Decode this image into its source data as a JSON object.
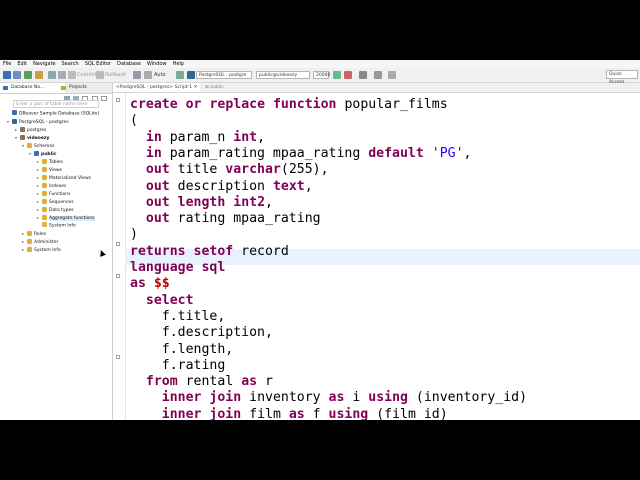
{
  "menu": [
    "File",
    "Edit",
    "Navigate",
    "Search",
    "SQL Editor",
    "Database",
    "Window",
    "Help"
  ],
  "toolbar": {
    "commit_label": "Commit",
    "rollback_label": "Rollback",
    "mode_label": "Auto",
    "datasource_combo": "PostgreSQL - postgre",
    "schema_combo": "public@videoezy",
    "limit_value": "20000",
    "quick_access_placeholder": "Quick Access"
  },
  "left_panel": {
    "tabs": [
      "Database Na...",
      "Projects"
    ],
    "filter_placeholder": "Enter a part of table name here",
    "tree": [
      {
        "label": "DBeaver Sample Database (SQLite)",
        "color": "#3b6fb6"
      },
      {
        "label": "PostgreSQL - postgres",
        "color": "#336791"
      },
      {
        "label": "postgres",
        "color": "#8d6e63"
      },
      {
        "label": "videoezy",
        "color": "#8d6e63"
      },
      {
        "label": "Schemas",
        "color": "#e0b040"
      },
      {
        "label": "public",
        "color": "#3b6fb6"
      },
      {
        "label": "Tables",
        "color": "#e0b040"
      },
      {
        "label": "Views",
        "color": "#e0b040"
      },
      {
        "label": "Materialized Views",
        "color": "#e0b040"
      },
      {
        "label": "Indexes",
        "color": "#e0b040"
      },
      {
        "label": "Functions",
        "color": "#e0b040"
      },
      {
        "label": "Sequences",
        "color": "#e0b040"
      },
      {
        "label": "Data types",
        "color": "#e0b040"
      },
      {
        "label": "Aggregate functions",
        "color": "#e0b040"
      },
      {
        "label": "System Info",
        "color": "#e0b040"
      },
      {
        "label": "Roles",
        "color": "#e0b040"
      },
      {
        "label": "Administer",
        "color": "#e0b040"
      },
      {
        "label": "System Info",
        "color": "#e0b040"
      }
    ]
  },
  "editor": {
    "tab_label": "<PostgreSQL - postgres> Script-1",
    "breadcrumb": "public",
    "code_lines": [
      "create or replace function popular_films",
      "(",
      "  in param_n int,",
      "  in param_rating mpaa_rating default 'PG',",
      "  out title varchar(255),",
      "  out description text,",
      "  out length int2,",
      "  out rating mpaa_rating",
      ")",
      "returns setof record",
      "language sql",
      "as $$",
      "  select",
      "    f.title,",
      "    f.description,",
      "    f.length,",
      "    f.rating",
      "  from rental as r",
      "    inner join inventory as i using (inventory_id)",
      "    inner join film as f using (film_id)"
    ]
  },
  "colors": {
    "keyword": "#7f0055",
    "string": "#2a00ff",
    "dollar": "#c00000",
    "current_line": "#e8f2fe"
  }
}
